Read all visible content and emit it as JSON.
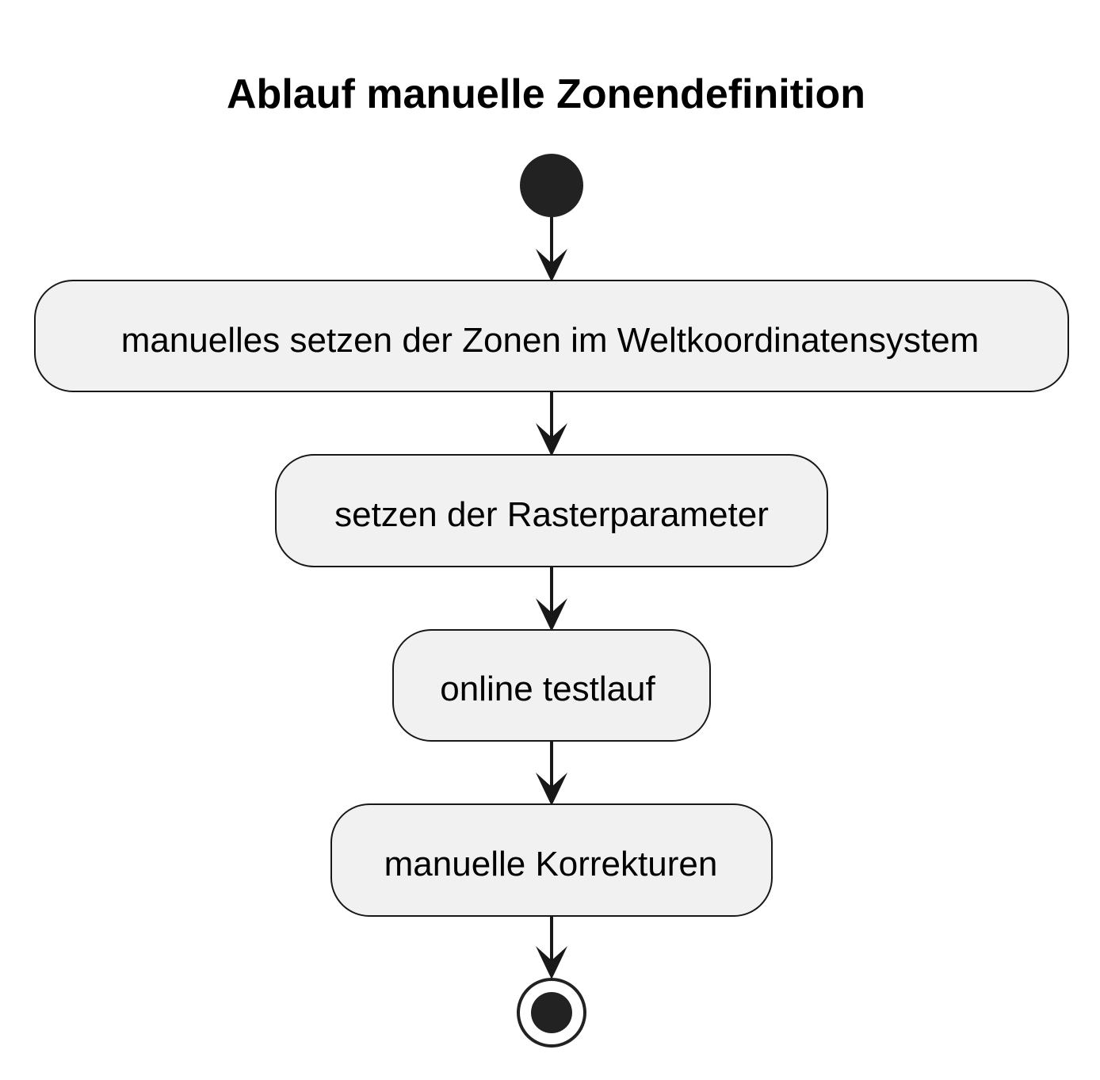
{
  "title": "Ablauf manuelle Zonendefinition",
  "diagram": {
    "type": "activity",
    "start": "start-node",
    "steps": [
      "manuelles setzen der Zonen im Weltkoordinatensystem",
      "setzen der Rasterparameter",
      "online testlauf",
      "manuelle Korrekturen"
    ],
    "end": "end-node"
  },
  "colors": {
    "node_fill": "#f1f1f1",
    "stroke": "#181818",
    "start_fill": "#222222",
    "text": "#000000"
  }
}
